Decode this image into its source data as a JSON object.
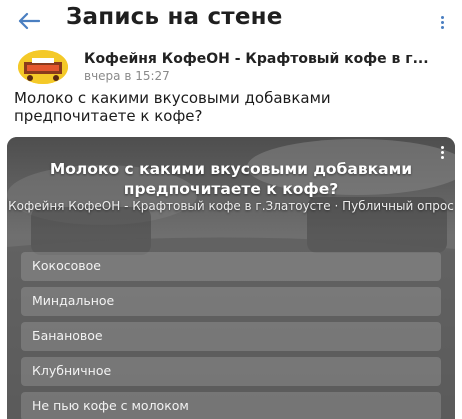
{
  "header": {
    "title": "Запись на стене",
    "back_icon": "arrow-left-icon",
    "more_icon": "more-vertical-icon",
    "accent_color": "#4a7fc1"
  },
  "post": {
    "author": "Кофейня КофеОН - Крафтовый кофе в г...",
    "time": "вчера в 15:27",
    "text": "Молоко с какими вкусовыми добавками предпочитаете к кофе?"
  },
  "poll": {
    "question": "Молоко с какими вкусовыми добавками предпочитаете к кофе?",
    "source": "Кофейня КофеОН - Крафтовый кофе в г.Златоусте · Публичный опрос",
    "options": [
      {
        "label": "Кокосовое"
      },
      {
        "label": "Миндальное"
      },
      {
        "label": "Банановое"
      },
      {
        "label": "Клубничное"
      },
      {
        "label": "Не пью кофе с молоком"
      }
    ]
  }
}
